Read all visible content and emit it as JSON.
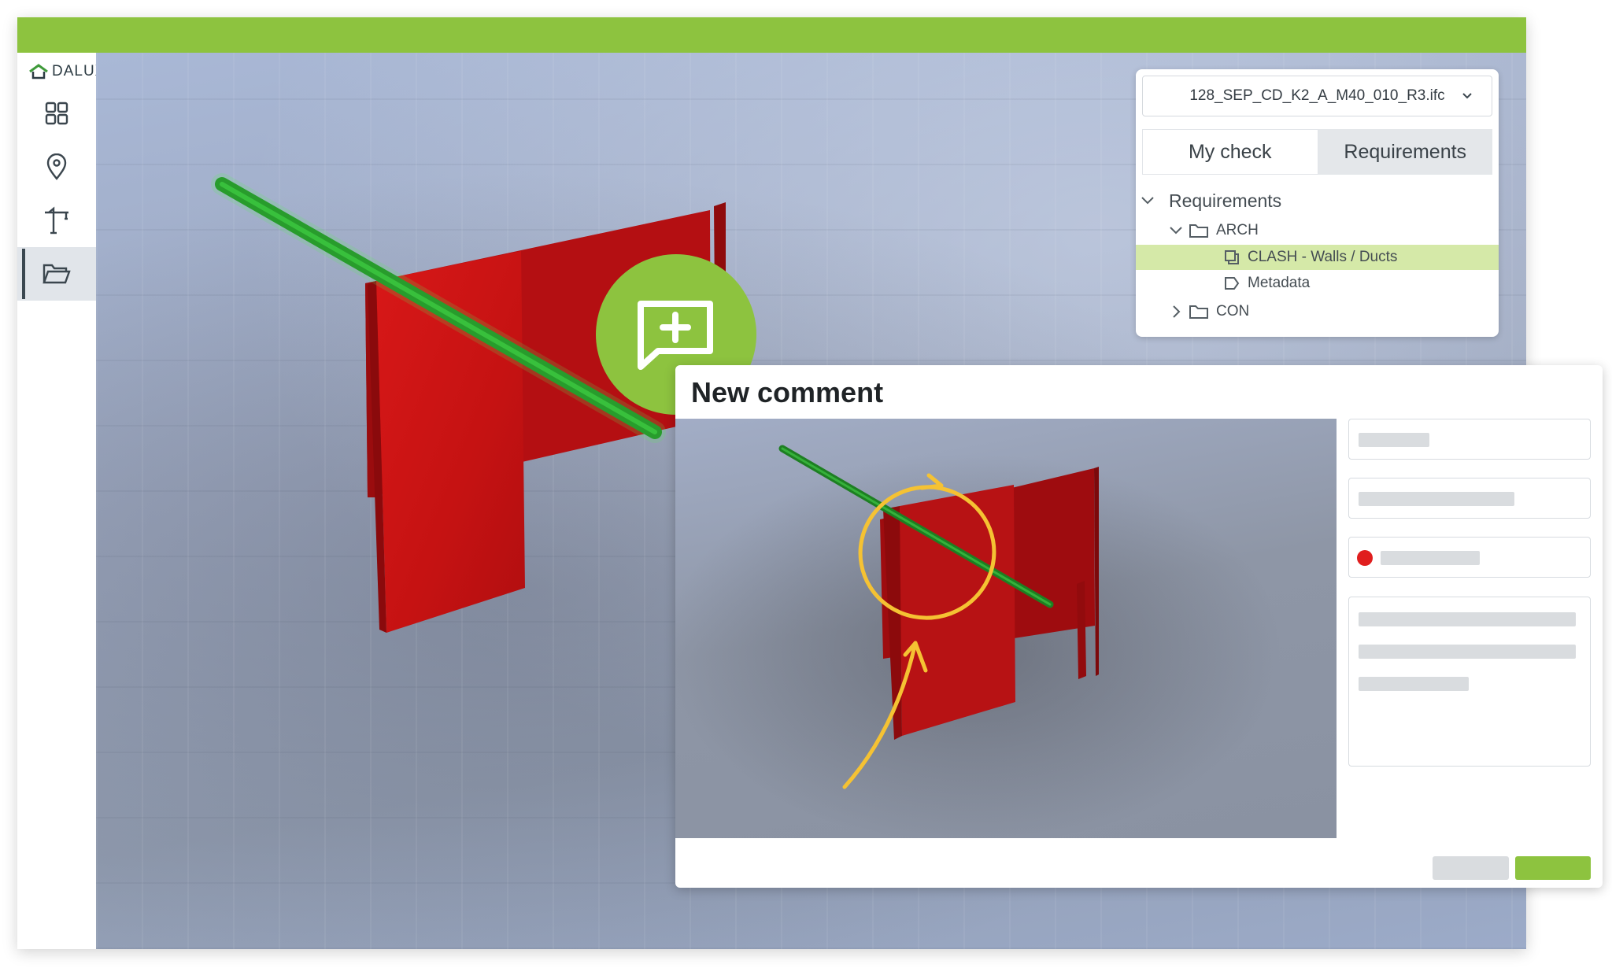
{
  "brand": {
    "name": "DALUX",
    "accent_color": "#8dc33f"
  },
  "sidebar": {
    "items": [
      {
        "icon": "grid-icon"
      },
      {
        "icon": "map-pin-icon"
      },
      {
        "icon": "crane-icon"
      },
      {
        "icon": "folder-open-icon",
        "active": true
      }
    ]
  },
  "file_panel": {
    "file_name": "128_SEP_CD_K2_A_M40_010_R3.ifc",
    "tabs": [
      "My check",
      "Requirements"
    ],
    "active_tab": "Requirements",
    "tree": {
      "root": "Requirements",
      "groups": [
        {
          "label": "ARCH",
          "expanded": true,
          "children": [
            "CLASH - Walls / Ducts",
            "Metadata"
          ]
        },
        {
          "label": "CON",
          "expanded": false
        }
      ],
      "selected": "CLASH - Walls / Ducts"
    }
  },
  "dialog": {
    "title": "New comment",
    "status_dot_color": "#e01e1e",
    "annotation_color": "#f5c233"
  },
  "icons": {
    "comment_add": "comment-plus-icon"
  }
}
